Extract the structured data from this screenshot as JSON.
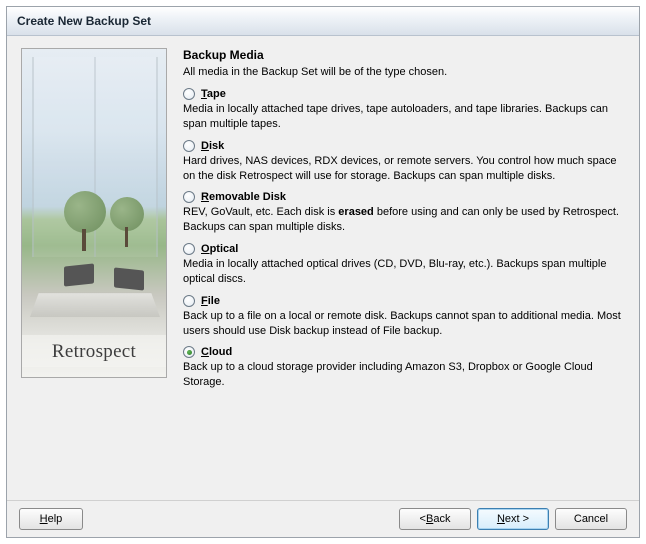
{
  "window": {
    "title": "Create New Backup Set"
  },
  "brand": "Retrospect",
  "heading": "Backup Media",
  "subheading": "All media in the Backup Set will be of the type chosen.",
  "options": {
    "tape": {
      "prefix": "T",
      "rest": "ape",
      "desc": "Media in locally attached tape drives, tape autoloaders, and tape libraries. Backups can span multiple tapes."
    },
    "disk": {
      "prefix": "D",
      "rest": "isk",
      "desc": "Hard drives, NAS devices, RDX devices, or remote servers. You control how much space on the disk Retrospect will use for storage. Backups can span multiple disks."
    },
    "removable": {
      "prefix": "R",
      "rest": "emovable Disk",
      "desc_before": "REV, GoVault, etc. Each disk is ",
      "desc_bold": "erased",
      "desc_after": " before using and can only be used by Retrospect. Backups can span multiple disks."
    },
    "optical": {
      "prefix": "O",
      "rest": "ptical",
      "desc": "Media in locally attached optical drives (CD, DVD, Blu-ray, etc.). Backups span multiple optical discs."
    },
    "file": {
      "prefix": "F",
      "rest": "ile",
      "desc": "Back up to a file on a local or remote disk. Backups cannot span to additional media. Most users should use Disk backup instead of File backup."
    },
    "cloud": {
      "prefix": "C",
      "rest": "loud",
      "desc": "Back up to a cloud storage provider including Amazon S3, Dropbox or Google Cloud Storage."
    }
  },
  "selected": "cloud",
  "buttons": {
    "help_ul": "H",
    "help_rest": "elp",
    "back_lt": "< ",
    "back_ul": "B",
    "back_rest": "ack",
    "next_ul": "N",
    "next_rest": "ext >",
    "cancel": "Cancel"
  }
}
